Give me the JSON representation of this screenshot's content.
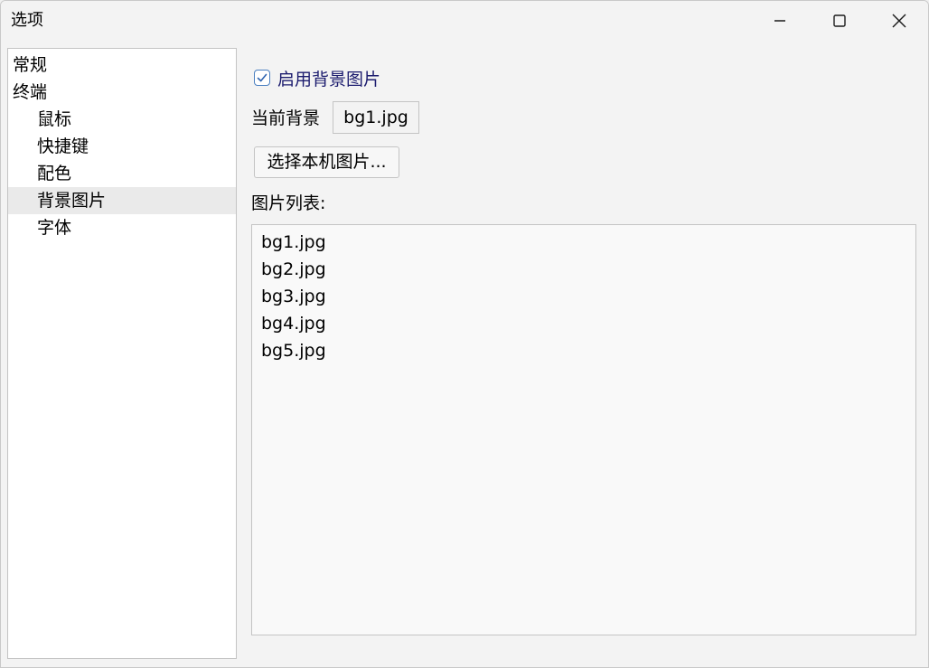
{
  "window": {
    "title": "选项"
  },
  "icons": {
    "minimize": "minimize-icon",
    "maximize": "maximize-icon",
    "close": "close-icon",
    "check": "checkmark-icon"
  },
  "nav": {
    "items": [
      {
        "label": "常规",
        "level": 0,
        "selected": false
      },
      {
        "label": "终端",
        "level": 0,
        "selected": false
      },
      {
        "label": "鼠标",
        "level": 1,
        "selected": false
      },
      {
        "label": "快捷键",
        "level": 1,
        "selected": false
      },
      {
        "label": "配色",
        "level": 1,
        "selected": false
      },
      {
        "label": "背景图片",
        "level": 1,
        "selected": true
      },
      {
        "label": "字体",
        "level": 1,
        "selected": false
      }
    ]
  },
  "background": {
    "enable_label": "启用背景图片",
    "enabled": true,
    "current_label": "当前背景",
    "current_value": "bg1.jpg",
    "choose_button": "选择本机图片...",
    "list_label": "图片列表:",
    "images": [
      "bg1.jpg",
      "bg2.jpg",
      "bg3.jpg",
      "bg4.jpg",
      "bg5.jpg"
    ]
  },
  "colors": {
    "checkbox_border": "#4a7fc0",
    "checkbox_label": "#1b1b6e",
    "selected_bg": "#eaeaea"
  }
}
